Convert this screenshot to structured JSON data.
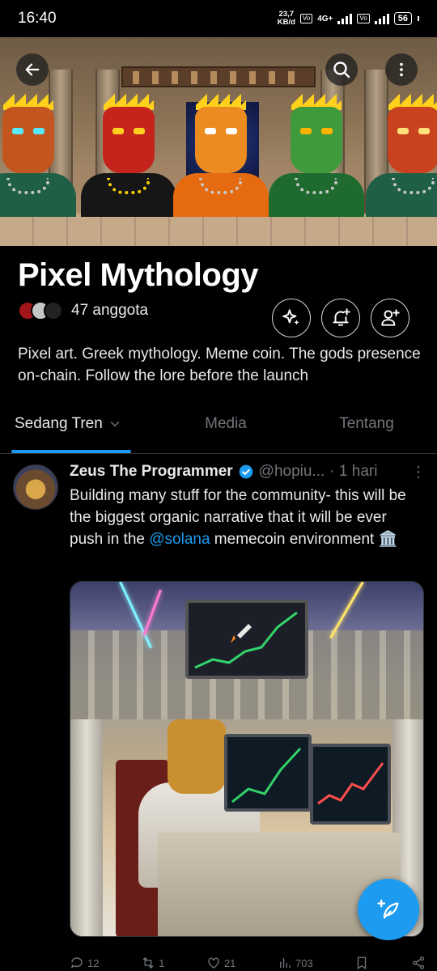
{
  "status_bar": {
    "time": "16:40",
    "speed_value": "23,7",
    "speed_unit": "KB/d",
    "net1": "Vo LTE",
    "net_type": "4G+",
    "net2": "Vo LTE",
    "battery": "56"
  },
  "header": {
    "title": "Pixel Mythology",
    "member_count": "47 anggota",
    "description": "Pixel art. Greek mythology. Meme coin. The gods presence on-chain. Follow the lore before the launch"
  },
  "icons": {
    "back": "arrow-left-icon",
    "search": "search-icon",
    "more": "more-vertical-icon",
    "sparkle": "sparkle-icon",
    "notify": "bell-plus-icon",
    "join": "user-plus-icon",
    "compose": "feather-plus-icon"
  },
  "tabs": [
    {
      "label": "Sedang Tren",
      "active": true
    },
    {
      "label": "Media",
      "active": false
    },
    {
      "label": "Tentang",
      "active": false
    }
  ],
  "post": {
    "author": "Zeus The Programmer",
    "handle": "@hopiu...",
    "time": "· 1 hari",
    "text_before": "Building many stuff for the community- this will be the biggest organic narrative that it will be ever push in the ",
    "mention": "@solana",
    "text_after": " memecoin environment 🏛️",
    "actions": [
      {
        "icon": "reply-icon",
        "count": "12"
      },
      {
        "icon": "repost-icon",
        "count": "1"
      },
      {
        "icon": "like-icon",
        "count": "21"
      },
      {
        "icon": "views-icon",
        "count": "703"
      }
    ]
  },
  "colors": {
    "accent": "#1d9bf0",
    "background": "#000000",
    "text_primary": "#e7e9ea",
    "text_secondary": "#71767b"
  }
}
